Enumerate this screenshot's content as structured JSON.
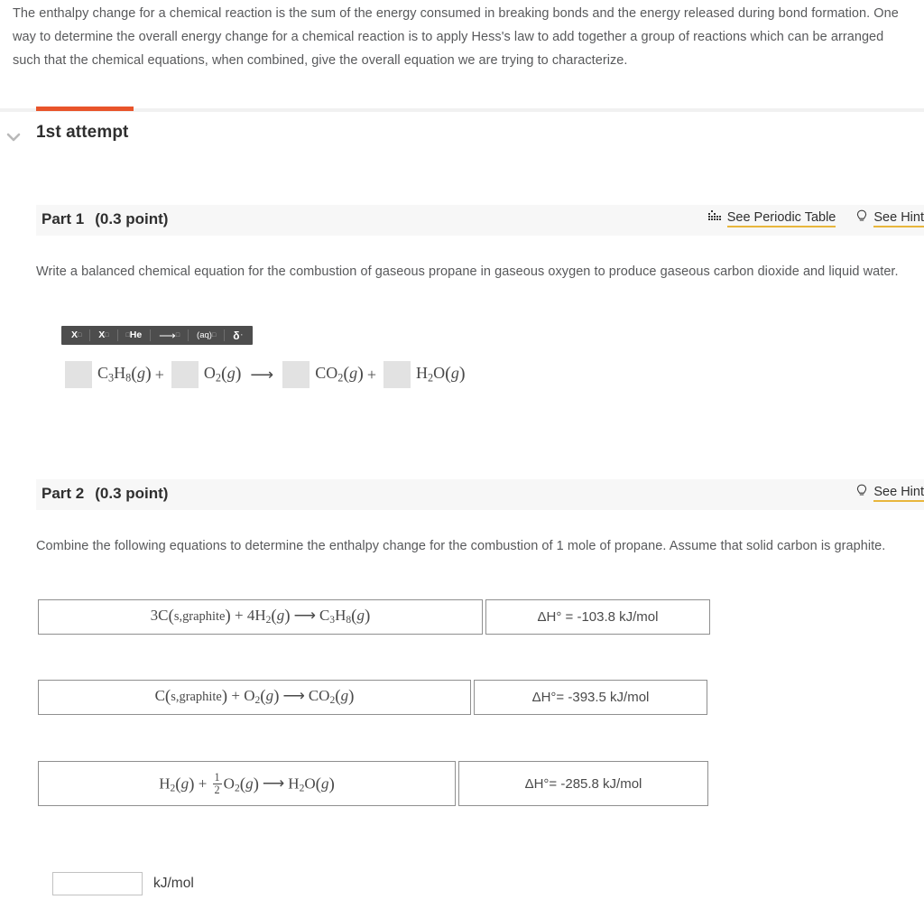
{
  "intro": {
    "paragraph": "The enthalpy change for a chemical reaction is the sum of the energy consumed in breaking bonds and the energy released during bond formation. One way to determine the overall energy change for a chemical reaction is to apply Hess's law to add together a group of reactions which can be arranged such that the chemical equations, when combined, give the overall equation we are trying to characterize."
  },
  "attempt": {
    "title": "1st attempt",
    "toggle_icon": "chevron-down-icon",
    "progress_color": "#e8542a"
  },
  "part1": {
    "label": "Part 1",
    "points": "(0.3 point)",
    "links": [
      {
        "label": "See Periodic Table",
        "icon": "periodic-table-icon"
      },
      {
        "label": "See Hint",
        "icon": "lightbulb-icon"
      }
    ],
    "prompt": "Write a balanced chemical equation for the combustion of gaseous propane in gaseous oxygen to produce gaseous carbon dioxide and liquid water.",
    "toolbar": [
      {
        "name": "superscript-button",
        "base": "X",
        "sup": "□"
      },
      {
        "name": "subscript-button",
        "base": "X",
        "sub": "□"
      },
      {
        "name": "isotope-button",
        "base": "He",
        "presub": "□"
      },
      {
        "name": "arrow-button",
        "base": "⟶",
        "sub": "□"
      },
      {
        "name": "phase-button",
        "base": "(aq)",
        "sub": "□"
      },
      {
        "name": "delta-button",
        "base": "δ",
        "sub": "·"
      }
    ],
    "equation": {
      "terms": [
        {
          "coefficient": "",
          "formula_html": "C<sub>3</sub>H<sub>8</sub><span class=\"paren\">(</span><span class=\"it\">g</span><span class=\"paren\">)</span>",
          "plain": "C3H8(g)"
        },
        {
          "coefficient": "",
          "formula_html": "O<sub>2</sub><span class=\"paren\">(</span><span class=\"it\">g</span><span class=\"paren\">)</span>",
          "plain": "O2(g)"
        },
        {
          "coefficient": "",
          "formula_html": "CO<sub>2</sub><span class=\"paren\">(</span><span class=\"it\">g</span><span class=\"paren\">)</span>",
          "plain": "CO2(g)"
        },
        {
          "coefficient": "",
          "formula_html": "H<sub>2</sub>O<span class=\"paren\">(</span><span class=\"it\">g</span><span class=\"paren\">)</span>",
          "plain": "H2O(g)"
        }
      ],
      "plus": "+",
      "arrow": "⟶"
    }
  },
  "part2": {
    "label": "Part 2",
    "points": "(0.3 point)",
    "links": [
      {
        "label": "See Hint",
        "icon": "lightbulb-icon"
      }
    ],
    "prompt": "Combine the following equations to determine the enthalpy change for the combustion of 1 mole of propane. Assume that solid carbon is graphite.",
    "equations": [
      {
        "equation_plain": "3C(s,graphite) + 4H2(g) ⟶ C3H8(g)",
        "equation_html": "3C<span class=\"paren\">(</span><span class=\"small\">s,graphite</span><span class=\"paren\">)</span> + 4H<sub>2</sub><span class=\"paren\">(</span><span class=\"it\">g</span><span class=\"paren\">)</span><span class=\"arr\">⟶</span>C<sub>3</sub>H<sub>8</sub><span class=\"paren\">(</span><span class=\"it\">g</span><span class=\"paren\">)</span>",
        "enthalpy": "ΔH° = -103.8 kJ/mol"
      },
      {
        "equation_plain": "C(s,graphite) + O2(g) ⟶ CO2(g)",
        "equation_html": "C<span class=\"paren\">(</span><span class=\"small\">s,graphite</span><span class=\"paren\">)</span> + O<sub>2</sub><span class=\"paren\">(</span><span class=\"it\">g</span><span class=\"paren\">)</span><span class=\"arr\">⟶</span>CO<sub>2</sub><span class=\"paren\">(</span><span class=\"it\">g</span><span class=\"paren\">)</span>",
        "enthalpy": "ΔH°= -393.5 kJ/mol"
      },
      {
        "equation_plain": "H2(g) + 1/2 O2(g) ⟶ H2O(g)",
        "equation_html": "H<sub>2</sub><span class=\"paren\">(</span><span class=\"it\">g</span><span class=\"paren\">)</span> + <span class=\"frac\"><span class=\"num\">1</span><span class=\"den\">2</span></span>O<sub>2</sub><span class=\"paren\">(</span><span class=\"it\">g</span><span class=\"paren\">)</span><span class=\"arr\">⟶</span>H<sub>2</sub>O<span class=\"paren\">(</span><span class=\"it\">g</span><span class=\"paren\">)</span>",
        "enthalpy": "ΔH°= -285.8 kJ/mol"
      }
    ],
    "answer": {
      "value": "",
      "placeholder": "",
      "unit": "kJ/mol"
    }
  }
}
